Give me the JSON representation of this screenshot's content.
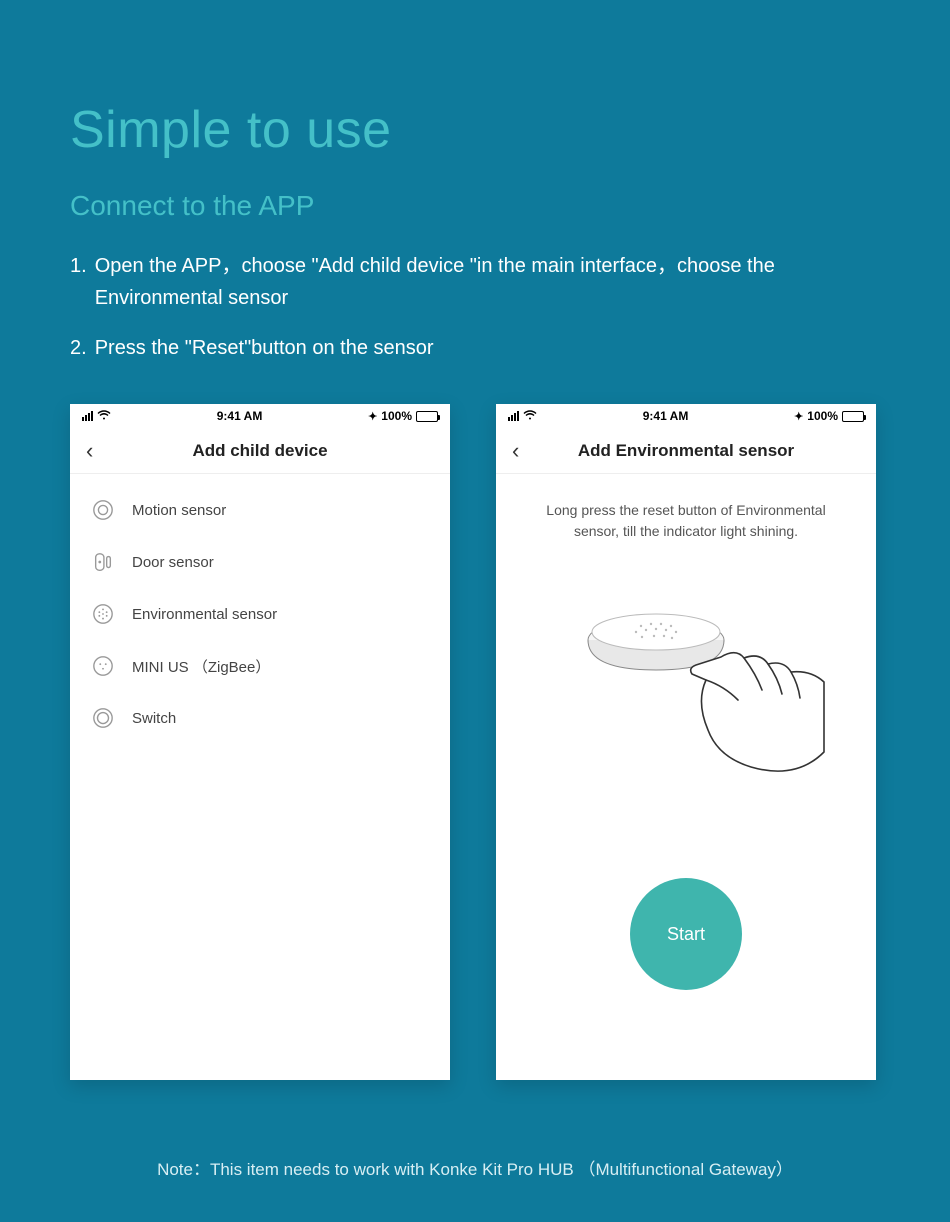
{
  "headline": "Simple to use",
  "subheadline": "Connect to the APP",
  "steps": [
    {
      "num": "1.",
      "text": "Open the APP，choose \"Add child device \"in the main interface，choose the Environmental sensor"
    },
    {
      "num": "2.",
      "text": "Press the \"Reset\"button on the sensor"
    }
  ],
  "status": {
    "time": "9:41 AM",
    "battery": "100%"
  },
  "phone1": {
    "title": "Add child device",
    "items": [
      {
        "label": "Motion sensor",
        "icon": "motion"
      },
      {
        "label": "Door sensor",
        "icon": "door"
      },
      {
        "label": "Environmental sensor",
        "icon": "env"
      },
      {
        "label": "MINI US （ZigBee）",
        "icon": "plug"
      },
      {
        "label": "Switch",
        "icon": "switch"
      }
    ]
  },
  "phone2": {
    "title": "Add Environmental sensor",
    "instruction": "Long press the reset button of Environmental sensor, till the indicator light shining.",
    "button": "Start"
  },
  "note": "Note：This item needs to work with Konke Kit Pro HUB （Multifunctional Gateway）"
}
